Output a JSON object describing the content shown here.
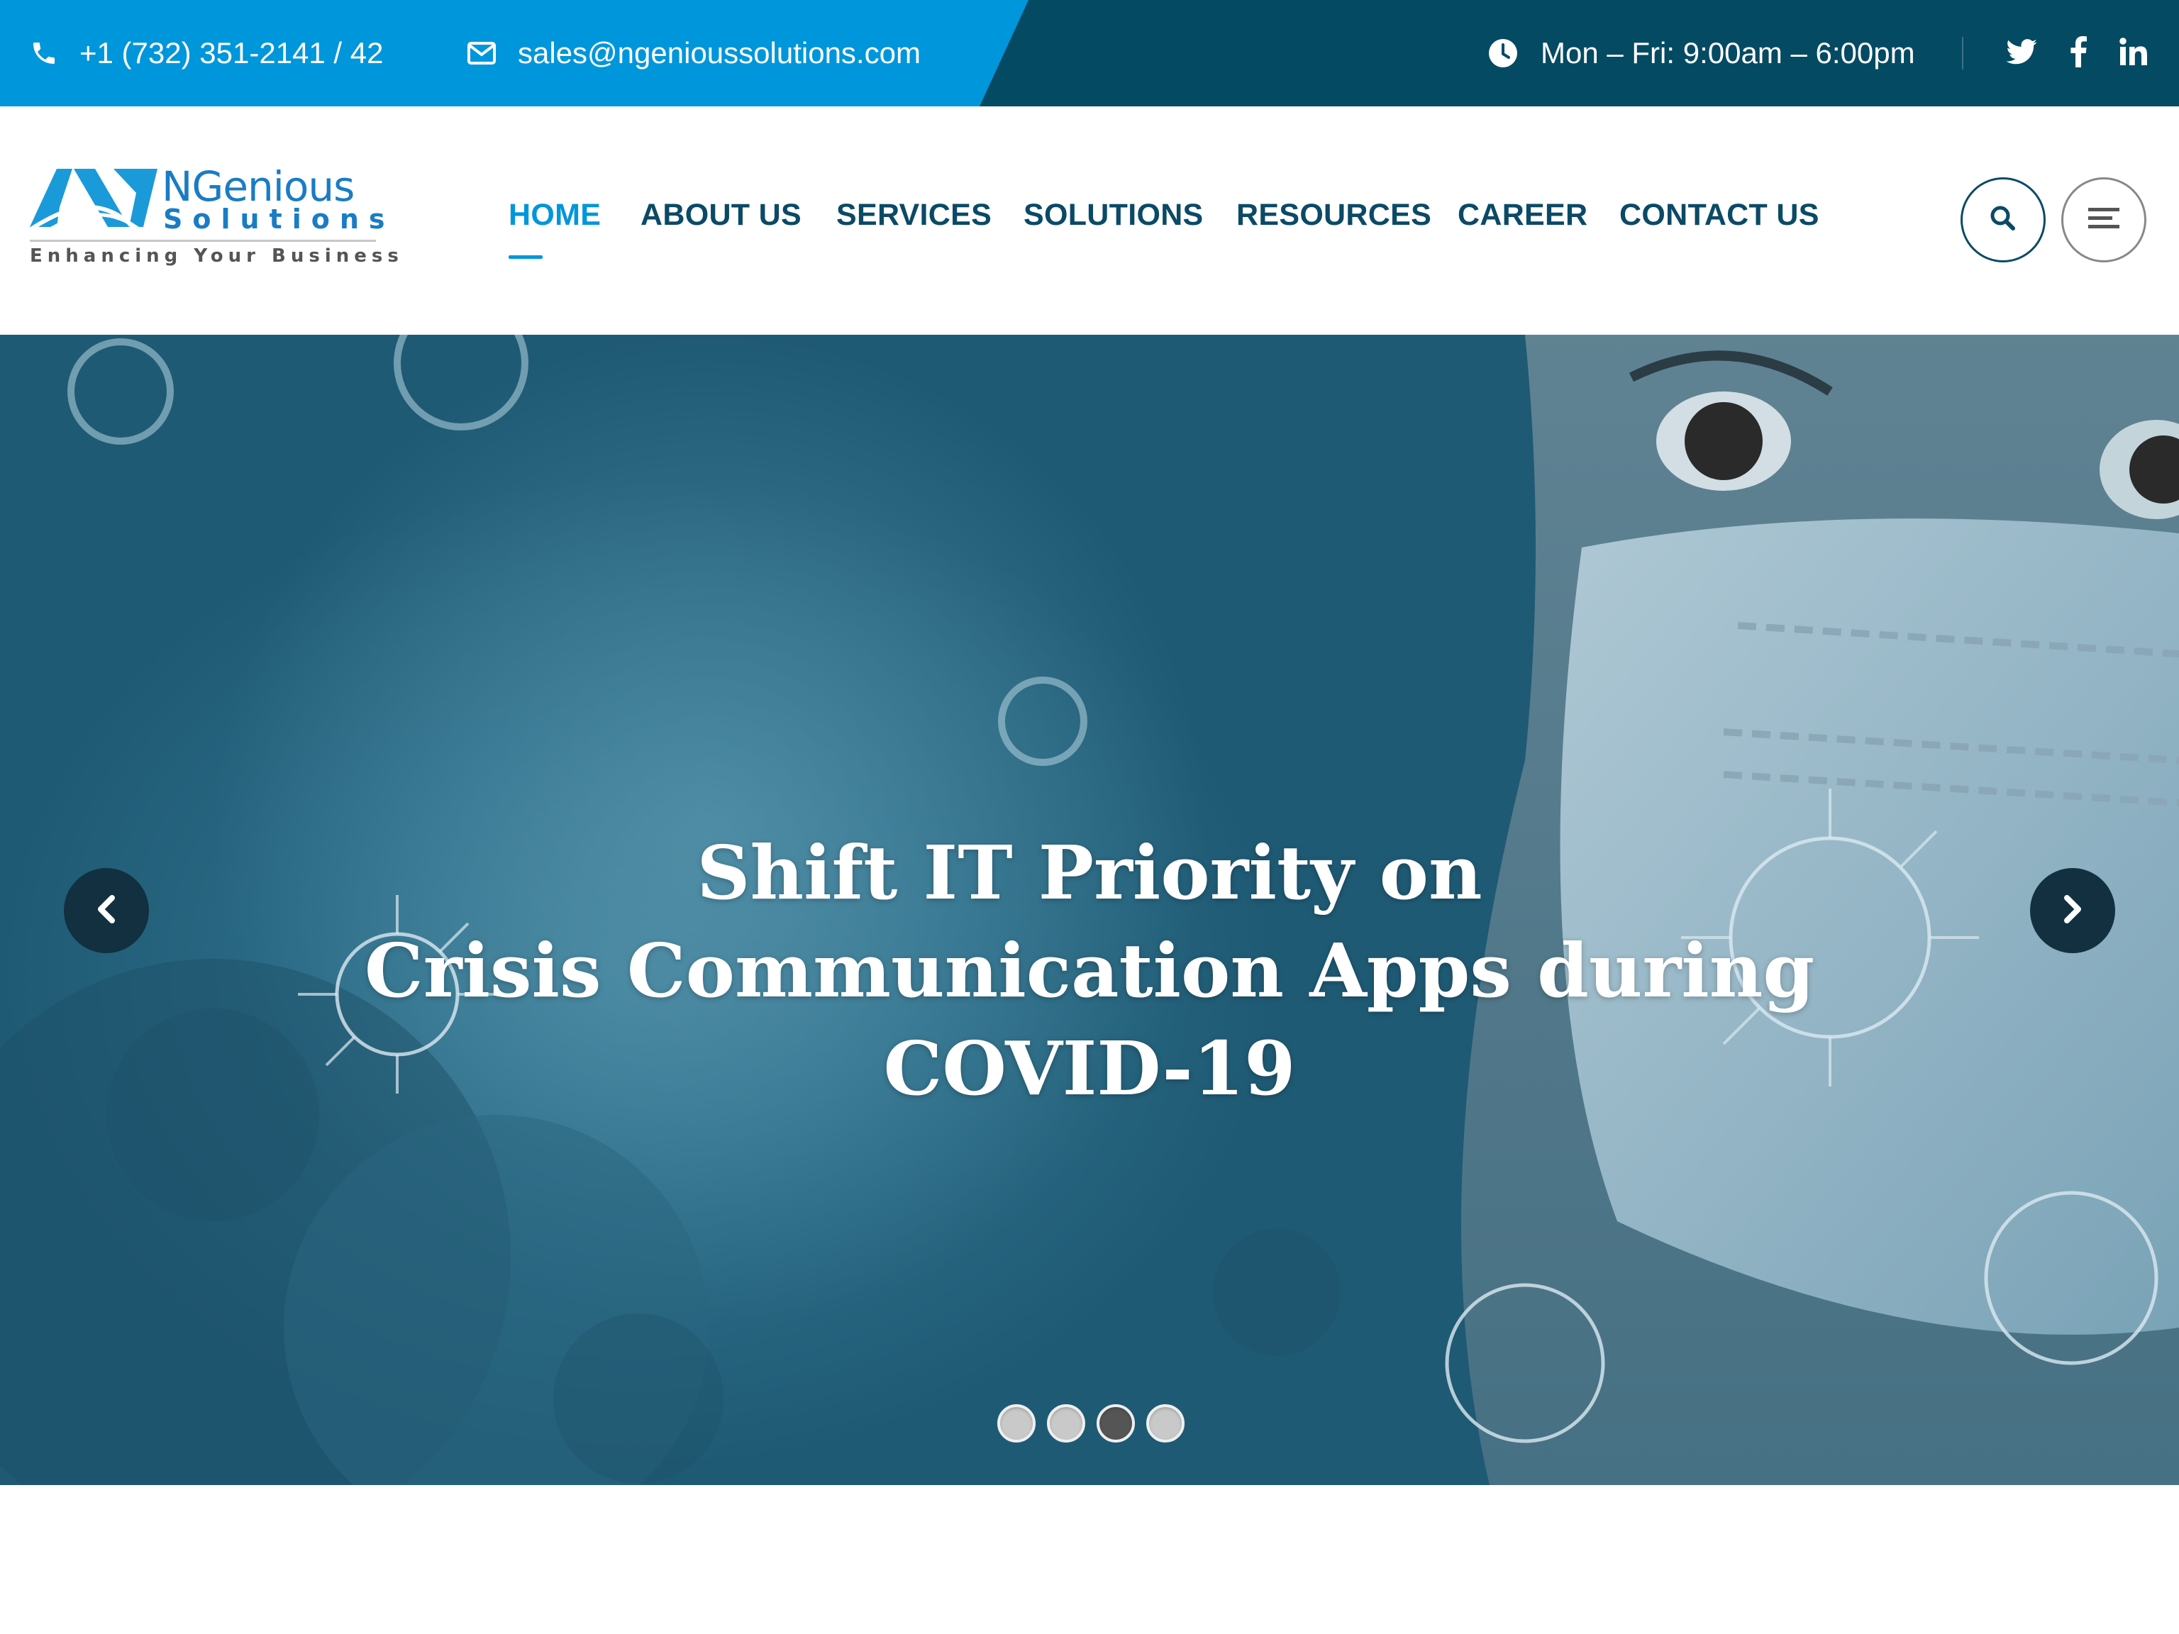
{
  "colors": {
    "topbar_dark": "#054a63",
    "topbar_blue": "#0096db",
    "nav_text": "#0b4a66",
    "nav_active": "#0096db",
    "logo_blue": "#1a7cc4"
  },
  "topbar": {
    "phone": {
      "icon": "phone-icon",
      "text": "+1 (732) 351-2141 / 42"
    },
    "email": {
      "icon": "envelope-icon",
      "text": "sales@ngenioussolutions.com"
    },
    "hours": {
      "icon": "clock-icon",
      "text": "Mon – Fri: 9:00am – 6:00pm"
    },
    "social": [
      {
        "icon": "twitter-icon"
      },
      {
        "icon": "facebook-icon"
      },
      {
        "icon": "linkedin-icon"
      }
    ]
  },
  "logo": {
    "name": "NGenious",
    "sub": "Solutions",
    "tagline": "Enhancing Your Business"
  },
  "nav": {
    "items": [
      {
        "label": "HOME",
        "active": true
      },
      {
        "label": "ABOUT US"
      },
      {
        "label": "SERVICES"
      },
      {
        "label": "SOLUTIONS"
      },
      {
        "label": "RESOURCES"
      },
      {
        "label": "CAREER"
      },
      {
        "label": "CONTACT US"
      }
    ],
    "search_icon": "search-icon",
    "menu_icon": "hamburger-menu-icon"
  },
  "hero": {
    "title_lines": [
      "Shift IT Priority on",
      "Crisis Communication Apps during",
      "COVID-19"
    ],
    "prev_icon": "chevron-left-icon",
    "next_icon": "chevron-right-icon",
    "slides_count": 4,
    "active_slide": 3
  }
}
